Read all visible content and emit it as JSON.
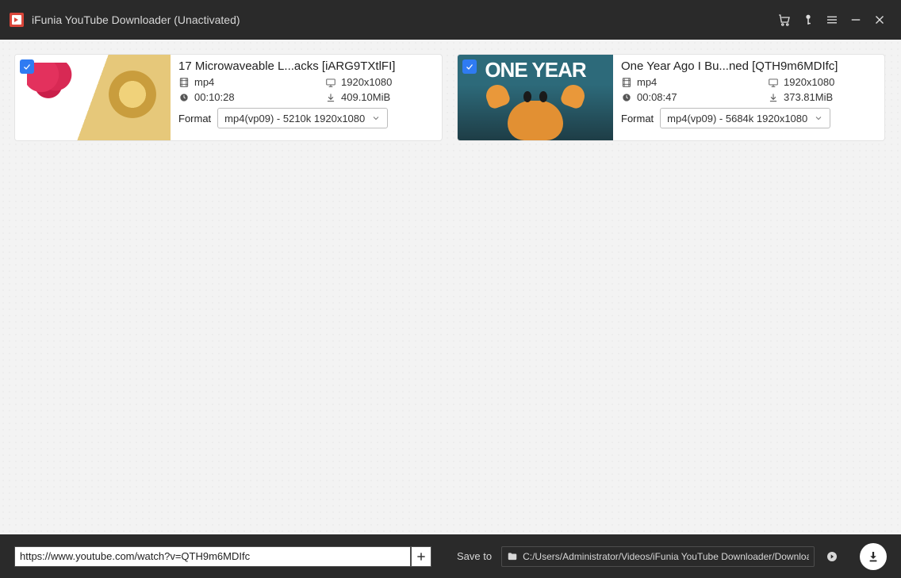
{
  "titlebar": {
    "title": "iFunia YouTube Downloader (Unactivated)"
  },
  "items": [
    {
      "title": "17 Microwaveable L...acks [iARG9TXtlFI]",
      "thumb_overlay": "",
      "container": "mp4",
      "resolution": "1920x1080",
      "duration": "00:10:28",
      "filesize": "409.10MiB",
      "format_label": "Format",
      "format_value": "mp4(vp09) - 5210k 1920x1080"
    },
    {
      "title": "One Year Ago I Bu...ned [QTH9m6MDIfc]",
      "thumb_overlay": "ONE YEAR",
      "container": "mp4",
      "resolution": "1920x1080",
      "duration": "00:08:47",
      "filesize": "373.81MiB",
      "format_label": "Format",
      "format_value": "mp4(vp09) - 5684k 1920x1080"
    }
  ],
  "bottombar": {
    "url_value": "https://www.youtube.com/watch?v=QTH9m6MDIfc",
    "save_to_label": "Save to",
    "save_path": "C:/Users/Administrator/Videos/iFunia YouTube Downloader/Download"
  }
}
